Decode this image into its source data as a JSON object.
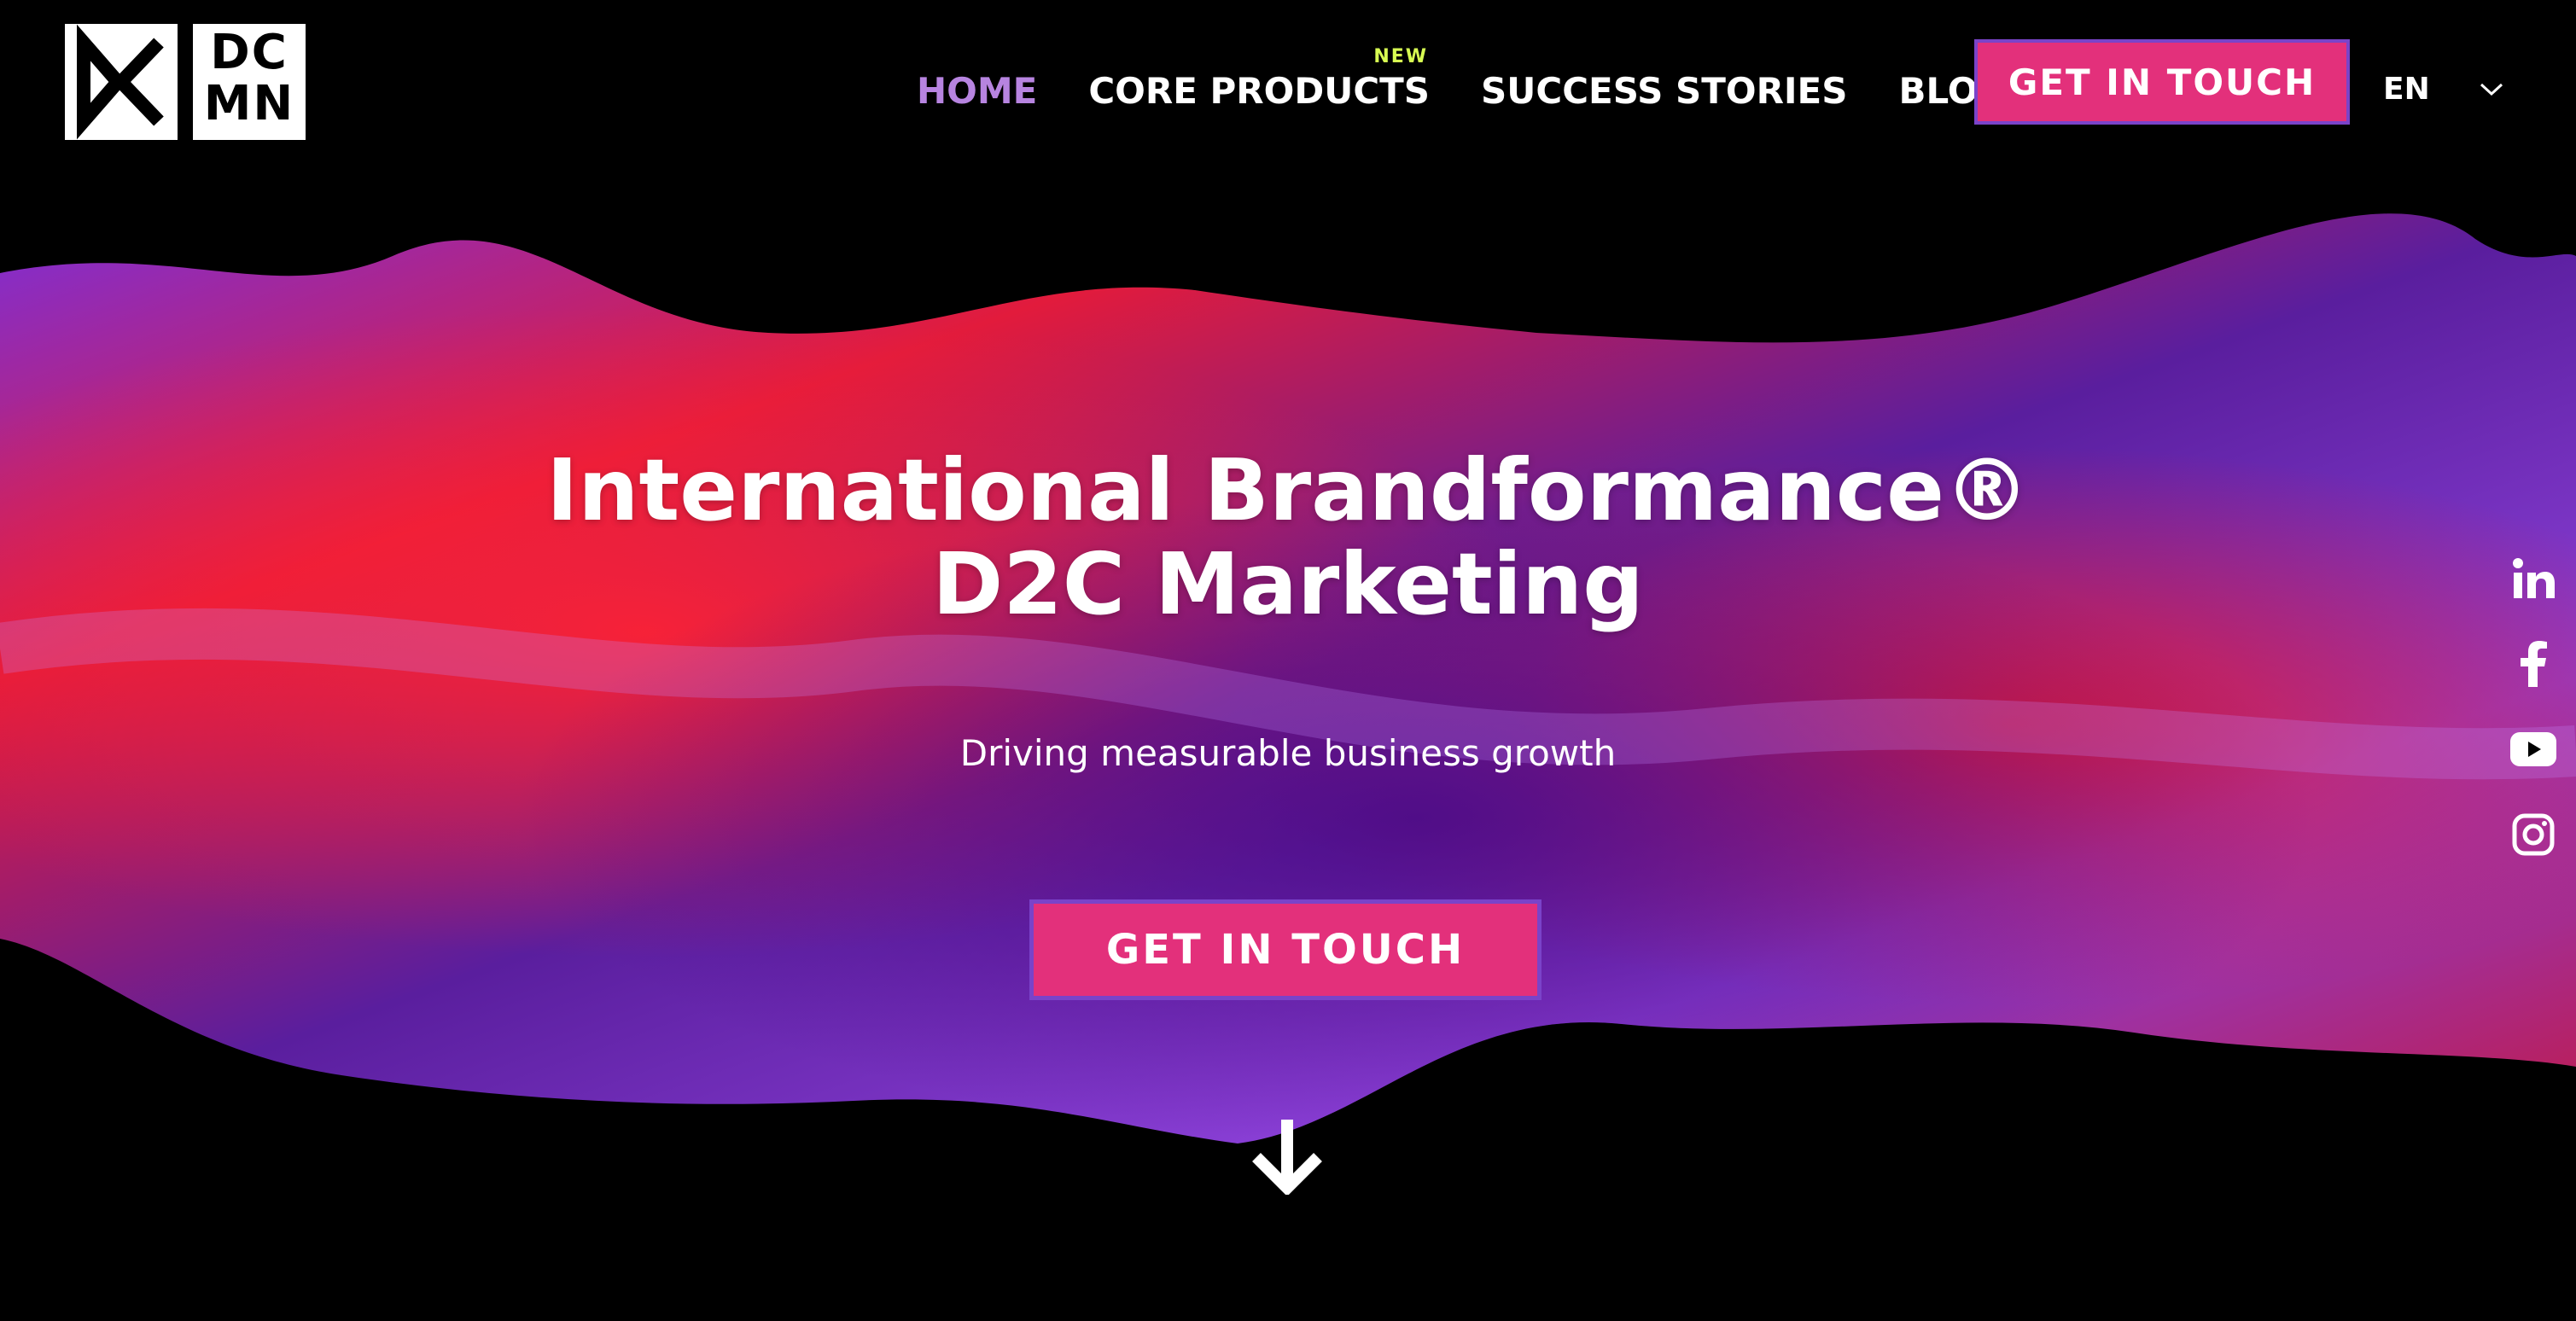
{
  "logo": {
    "letters_line1": "DC",
    "letters_line2": "MN"
  },
  "nav": {
    "items": [
      {
        "label": "HOME",
        "active": true
      },
      {
        "label": "CORE PRODUCTS",
        "badge": "NEW"
      },
      {
        "label": "SUCCESS STORIES"
      },
      {
        "label": "BLOG"
      }
    ],
    "cta_label": "GET IN TOUCH",
    "language": "EN"
  },
  "hero": {
    "title_line1": "International Brandformance®",
    "title_line2": "D2C Marketing",
    "subtitle": "Driving measurable business growth",
    "cta_label": "GET IN TOUCH"
  },
  "social": [
    "linkedin-icon",
    "facebook-icon",
    "youtube-icon",
    "instagram-icon"
  ],
  "colors": {
    "accent_pink": "#e3307b",
    "accent_purple": "#7a43c9",
    "nav_active": "#b784e0",
    "badge": "#d8ff52",
    "bg": "#000000"
  }
}
